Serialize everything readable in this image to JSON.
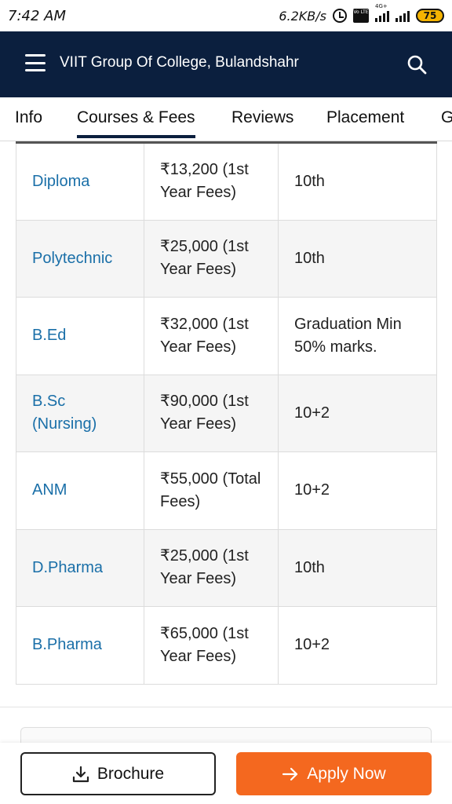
{
  "status_bar": {
    "time": "7:42 AM",
    "speed": "6.2KB/s",
    "network_label": "4G+",
    "volte_label": "Vo LTE",
    "battery": "75"
  },
  "header": {
    "title": "VIIT Group Of College, Bulandshahr"
  },
  "tabs": [
    {
      "label": "Info"
    },
    {
      "label": "Courses & Fees",
      "active": true
    },
    {
      "label": "Reviews"
    },
    {
      "label": "Placement"
    },
    {
      "label": "G"
    }
  ],
  "fees_table": {
    "rows": [
      {
        "course": "Diploma",
        "fee": "₹13,200 (1st Year Fees)",
        "eligibility": "10th"
      },
      {
        "course": "Polytechnic",
        "fee": "₹25,000 (1st Year Fees)",
        "eligibility": "10th"
      },
      {
        "course": "B.Ed",
        "fee": "₹32,000 (1st Year Fees)",
        "eligibility": "Graduation Min 50% marks."
      },
      {
        "course": "B.Sc (Nursing)",
        "fee": "₹90,000 (1st Year Fees)",
        "eligibility": "10+2"
      },
      {
        "course": "ANM",
        "fee": "₹55,000 (Total Fees)",
        "eligibility": "10+2"
      },
      {
        "course": "D.Pharma",
        "fee": "₹25,000 (1st Year Fees)",
        "eligibility": "10th"
      },
      {
        "course": "B.Pharma",
        "fee": "₹65,000 (1st Year Fees)",
        "eligibility": "10+2"
      }
    ]
  },
  "bottom_bar": {
    "brochure_label": "Brochure",
    "apply_label": "Apply Now"
  },
  "colors": {
    "header_bg": "#0b1f3e",
    "course_link": "#1a6fa8",
    "apply_button": "#f4681f"
  },
  "icons": {
    "menu": "hamburger-menu-icon",
    "search": "search-icon",
    "brochure": "download-icon",
    "apply": "arrow-right-icon"
  }
}
